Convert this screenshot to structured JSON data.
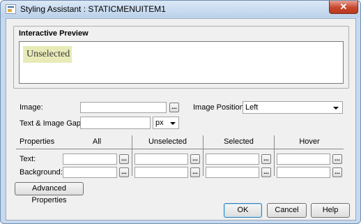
{
  "window": {
    "title": "Styling Assistant : STATICMENUITEM1",
    "close_glyph": "✕"
  },
  "preview": {
    "group_label": "Interactive Preview",
    "item_text": "Unselected",
    "item_bg_color": "#e8ebb8"
  },
  "image": {
    "label": "Image:",
    "value": "",
    "browse_label": "..."
  },
  "image_position": {
    "label": "Image Position:",
    "selected": "Left"
  },
  "gap": {
    "label": "Text & Image Gap:",
    "value": "",
    "unit": "px"
  },
  "properties": {
    "columns": [
      "Properties",
      "All",
      "Unselected",
      "Selected",
      "Hover"
    ],
    "rows": [
      {
        "label": "Text:"
      },
      {
        "label": "Background:"
      }
    ],
    "browse_label": "..."
  },
  "buttons": {
    "advanced": "Advanced Properties",
    "ok": "OK",
    "cancel": "Cancel",
    "help": "Help"
  }
}
